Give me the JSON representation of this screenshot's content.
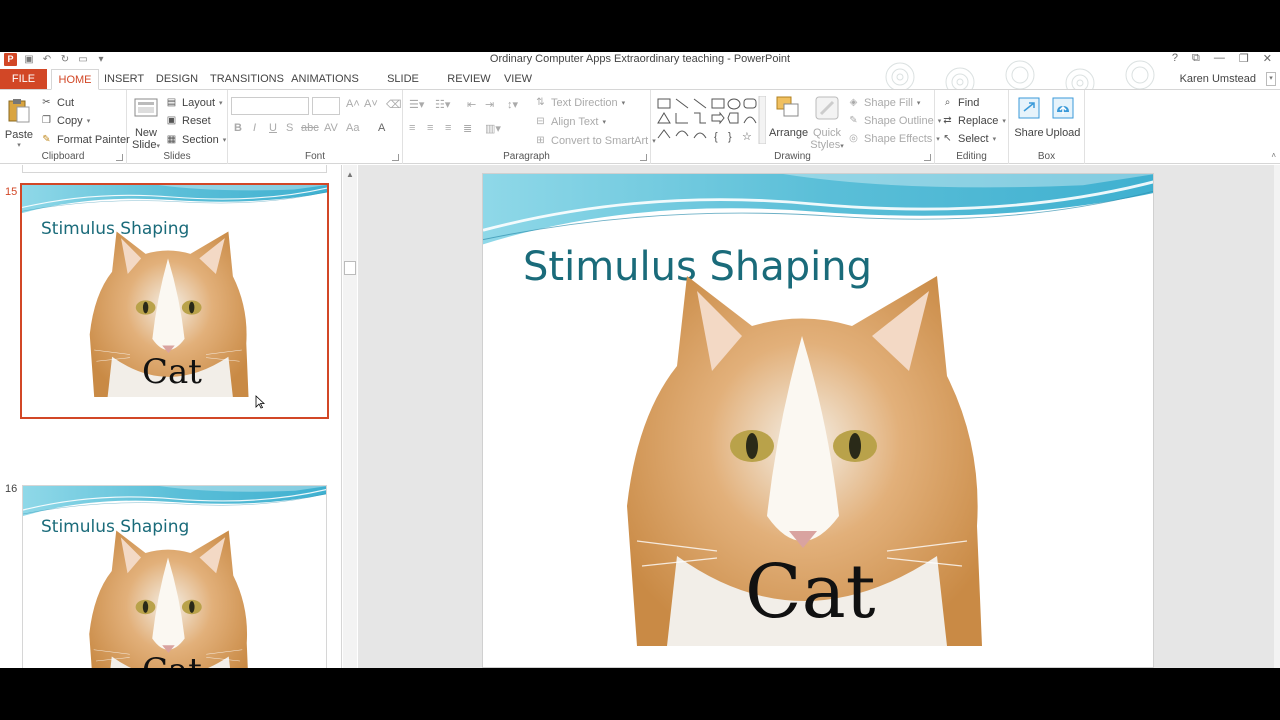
{
  "window": {
    "title": "Ordinary Computer Apps Extraordinary teaching - PowerPoint",
    "app_icon": "P",
    "controls": [
      "?",
      "⧉",
      "—",
      "❐",
      "✕"
    ]
  },
  "tabs": [
    "FILE",
    "HOME",
    "INSERT",
    "DESIGN",
    "TRANSITIONS",
    "ANIMATIONS",
    "SLIDE SHOW",
    "REVIEW",
    "VIEW"
  ],
  "user": "Karen Umstead",
  "ribbon": {
    "clipboard": {
      "label": "Clipboard",
      "paste": "Paste",
      "cut": "Cut",
      "copy": "Copy",
      "format_painter": "Format Painter"
    },
    "slides": {
      "label": "Slides",
      "new_slide_1": "New",
      "new_slide_2": "Slide",
      "layout": "Layout",
      "reset": "Reset",
      "section": "Section"
    },
    "font": {
      "label": "Font"
    },
    "paragraph": {
      "label": "Paragraph",
      "text_direction": "Text Direction",
      "align_text": "Align Text",
      "convert_smartart": "Convert to SmartArt"
    },
    "drawing": {
      "label": "Drawing",
      "arrange": "Arrange",
      "quick_styles_1": "Quick",
      "quick_styles_2": "Styles",
      "shape_fill": "Shape Fill",
      "shape_outline": "Shape Outline",
      "shape_effects": "Shape Effects"
    },
    "editing": {
      "label": "Editing",
      "find": "Find",
      "replace": "Replace",
      "select": "Select"
    },
    "box": {
      "label": "Box",
      "share": "Share",
      "upload": "Upload"
    }
  },
  "slides": [
    {
      "number": "15",
      "title": "Stimulus Shaping",
      "caption": "Cat",
      "selected": true
    },
    {
      "number": "16",
      "title": "Stimulus Shaping",
      "caption": "Cat",
      "selected": false
    }
  ],
  "current_slide": {
    "title": "Stimulus Shaping",
    "caption": "Cat"
  },
  "colors": {
    "accent": "#d24726",
    "title_teal": "#1a6b7a",
    "wave": "#6ec6dc"
  }
}
